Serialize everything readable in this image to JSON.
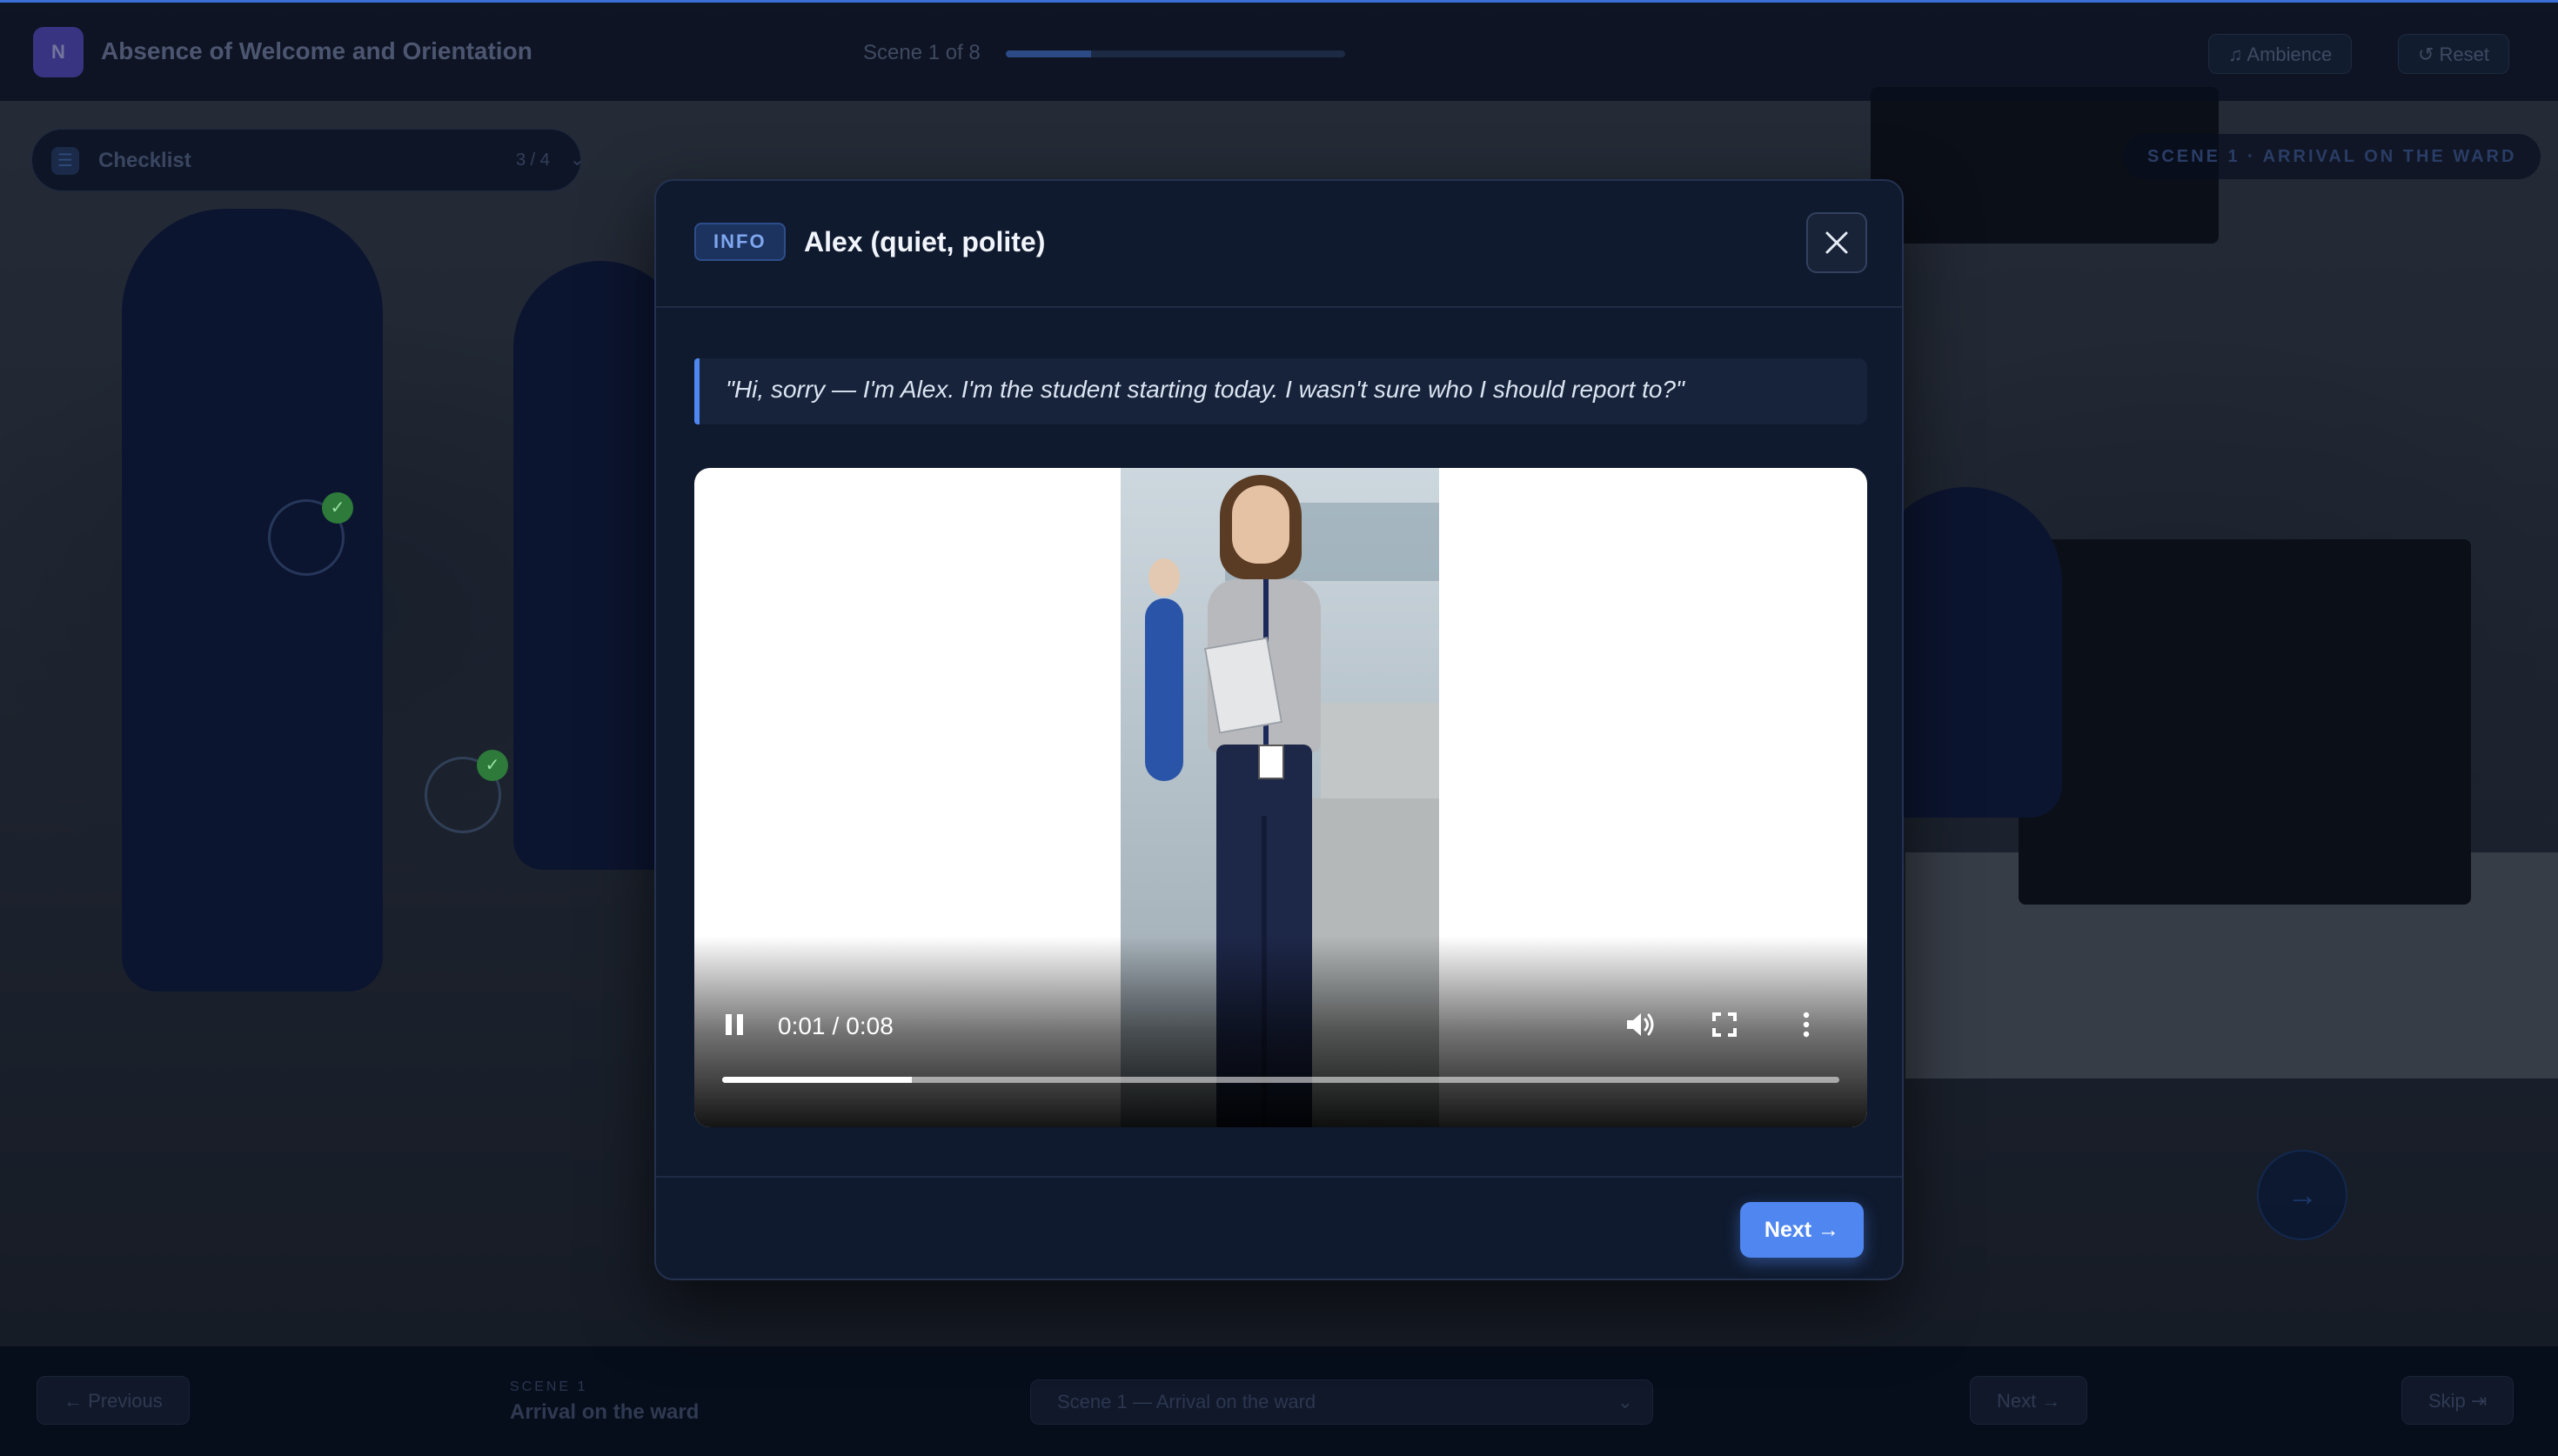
{
  "app": {
    "logo_text": "N",
    "title": "Absence of Welcome and Orientation",
    "scene_count": "Scene 1 of 8",
    "scene_progress": 0.25,
    "ambience_label": "♫ Ambience",
    "reset_label": "↺ Reset"
  },
  "checklist": {
    "label": "Checklist",
    "count": "3 / 4",
    "chevron": "⌄"
  },
  "scene_tag": "SCENE 1 · ARRIVAL ON THE WARD",
  "bottom_bar": {
    "previous_label": "← Previous",
    "scene_kicker": "SCENE 1",
    "scene_title": "Arrival on the ward",
    "scene_select_value": "Scene 1 — Arrival on the ward",
    "next_label": "Next →",
    "skip_label": "Skip ⇥"
  },
  "modal": {
    "badge": "INFO",
    "title": "Alex (quiet, polite)",
    "quote": "\"Hi, sorry — I'm Alex. I'm the student starting today. I wasn't sure who I should report to?\"",
    "video": {
      "current_time": "0:01",
      "separator": "/",
      "duration": "0:08",
      "progress": 0.17
    },
    "next_label": "Next →"
  },
  "colors": {
    "accent": "#4f86f0",
    "modal_bg": "#0f1a2e",
    "badge_text": "#7fa6ef",
    "checkmark": "#2d7a3a"
  },
  "icons": {
    "close": "close-icon",
    "play_pause": "pause-icon",
    "volume": "volume-icon",
    "fullscreen": "fullscreen-icon",
    "more": "more-vertical-icon"
  }
}
